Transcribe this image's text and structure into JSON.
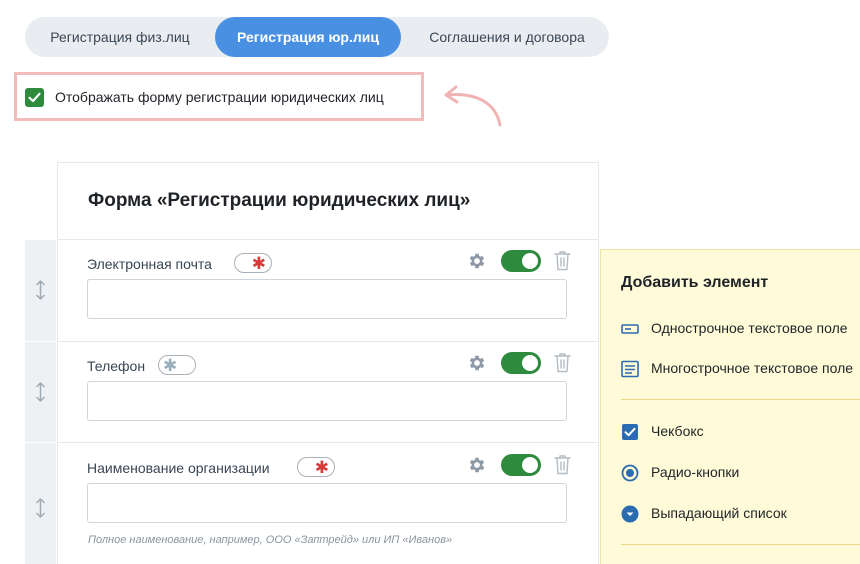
{
  "tabs": {
    "items": [
      {
        "label": "Регистрация физ.лиц"
      },
      {
        "label": "Регистрация юр.лиц",
        "active": true
      },
      {
        "label": "Соглашения и договора"
      }
    ]
  },
  "show_form": {
    "label": "Отображать форму регистрации юридических лиц",
    "checked": true
  },
  "form": {
    "title": "Форма «Регистрации юридических лиц»",
    "fields": [
      {
        "label": "Электронная почта",
        "required": true,
        "enabled": true,
        "value": "",
        "hint": ""
      },
      {
        "label": "Телефон",
        "required": false,
        "enabled": true,
        "value": "",
        "hint": ""
      },
      {
        "label": "Наименование организации",
        "required": true,
        "enabled": true,
        "value": "",
        "hint": "Полное наименование, например, ООО «Заптрейд» или ИП «Иванов»"
      }
    ]
  },
  "panel": {
    "title": "Добавить элемент",
    "items": [
      {
        "label": "Однострочное текстовое поле",
        "icon": "single-line-field-icon"
      },
      {
        "label": "Многострочное текстовое поле",
        "icon": "multi-line-field-icon"
      },
      {
        "label": "Чекбокс",
        "icon": "checkbox-icon"
      },
      {
        "label": "Радио-кнопки",
        "icon": "radio-icon"
      },
      {
        "label": "Выпадающий список",
        "icon": "dropdown-icon"
      }
    ]
  },
  "colors": {
    "accent": "#4a90e2",
    "success": "#2e8b3d",
    "required_star": "#d63a3a",
    "panel_bg": "#fffbd8",
    "highlight_border": "#f2bcbc"
  }
}
